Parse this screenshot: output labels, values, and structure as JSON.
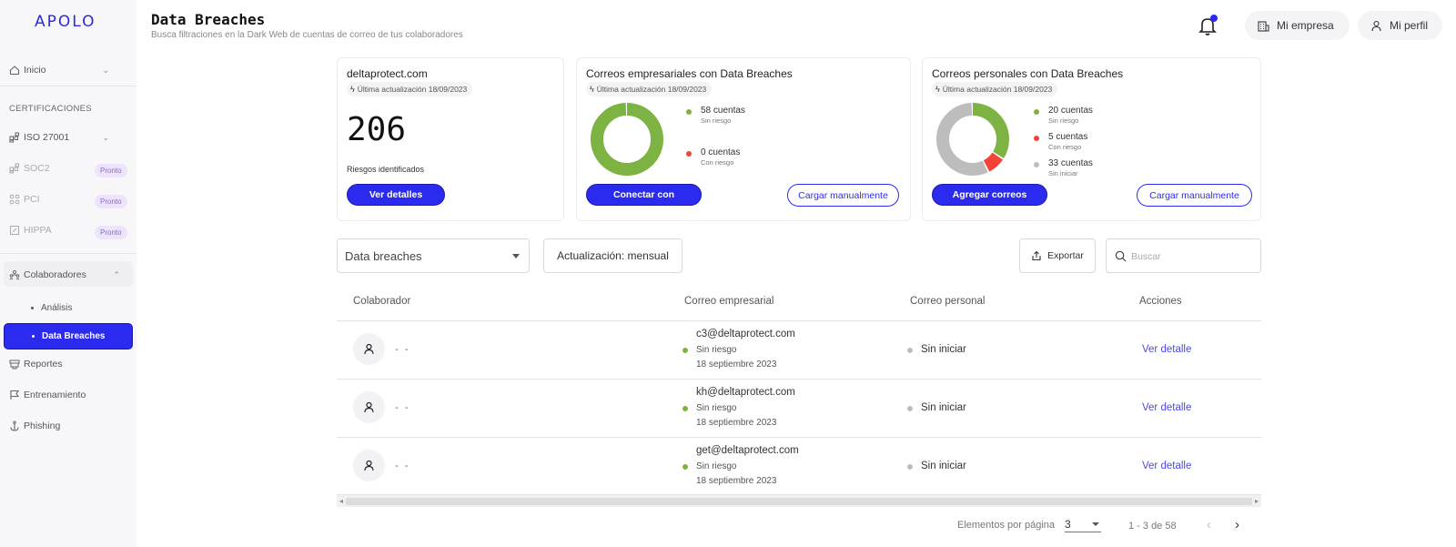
{
  "app": {
    "logo": "APOLO"
  },
  "sidebar": {
    "inicio": "Inicio",
    "section_certificaciones": "CERTIFICACIONES",
    "items": [
      {
        "label": "ISO 27001"
      },
      {
        "label": "SOC2",
        "badge": "Pronto"
      },
      {
        "label": "PCI",
        "badge": "Pronto"
      },
      {
        "label": "HIPPA",
        "badge": "Pronto"
      }
    ],
    "colaboradores": "Colaboradores",
    "sub_analisis": "Análisis",
    "sub_breaches": "Data Breaches",
    "reportes": "Reportes",
    "entrenamiento": "Entrenamiento",
    "phishing": "Phishing"
  },
  "header": {
    "title": "Data Breaches",
    "subtitle": "Busca filtraciones en la Dark Web de cuentas de correo de tus colaboradores",
    "empresa": "Mi empresa",
    "perfil": "Mi perfil"
  },
  "cards": {
    "domain": {
      "title": "deltaprotect.com",
      "updated": "Última actualización 18/09/2023",
      "risks": "206",
      "risks_label": "Riesgos identificados",
      "button": "Ver detalles"
    },
    "business": {
      "title": "Correos empresariales con Data Breaches",
      "updated": "Última actualización 18/09/2023",
      "legend": [
        {
          "main": "58 cuentas",
          "sub": "Sin riesgo"
        },
        {
          "main": "0 cuentas",
          "sub": "Con riesgo"
        }
      ],
      "button_primary": "Conectar con",
      "button_outline": "Cargar manualmente"
    },
    "personal": {
      "title": "Correos personales con Data Breaches",
      "updated": "Última actualización 18/09/2023",
      "legend": [
        {
          "main": "20 cuentas",
          "sub": "Sin riesgo"
        },
        {
          "main": "5 cuentas",
          "sub": "Con riesgo"
        },
        {
          "main": "33 cuentas",
          "sub": "Sin iniciar"
        }
      ],
      "button_primary": "Agregar correos",
      "button_outline": "Cargar manualmente"
    }
  },
  "chart_data": [
    {
      "type": "pie",
      "categories": [
        "Sin riesgo",
        "Con riesgo"
      ],
      "values": [
        58,
        0
      ],
      "colors": [
        "#7cb342",
        "#f44336"
      ]
    },
    {
      "type": "pie",
      "categories": [
        "Sin riesgo",
        "Con riesgo",
        "Sin iniciar"
      ],
      "values": [
        20,
        5,
        33
      ],
      "colors": [
        "#7cb342",
        "#f44336",
        "#bdbdbd"
      ]
    }
  ],
  "filters": {
    "select_value": "Data breaches",
    "update_label": "Actualización: mensual",
    "export": "Exportar",
    "search_placeholder": "Buscar"
  },
  "table": {
    "headers": [
      "Colaborador",
      "Correo empresarial",
      "Correo personal",
      "Acciones"
    ],
    "rows": [
      {
        "name": "- -",
        "email": "c3@deltaprotect.com",
        "status": "Sin riesgo",
        "date": "18 septiembre 2023",
        "personal": "Sin iniciar",
        "action": "Ver detalle"
      },
      {
        "name": "- -",
        "email": "kh@deltaprotect.com",
        "status": "Sin riesgo",
        "date": "18 septiembre 2023",
        "personal": "Sin iniciar",
        "action": "Ver detalle"
      },
      {
        "name": "- -",
        "email": "get@deltaprotect.com",
        "status": "Sin riesgo",
        "date": "18 septiembre 2023",
        "personal": "Sin iniciar",
        "action": "Ver detalle"
      }
    ]
  },
  "pagination": {
    "label": "Elementos por página",
    "per_page": "3",
    "range": "1 - 3 de 58"
  },
  "colors": {
    "accent": "#2b2bef",
    "green": "#7cb342",
    "red": "#f44336",
    "gray": "#bdbdbd"
  }
}
